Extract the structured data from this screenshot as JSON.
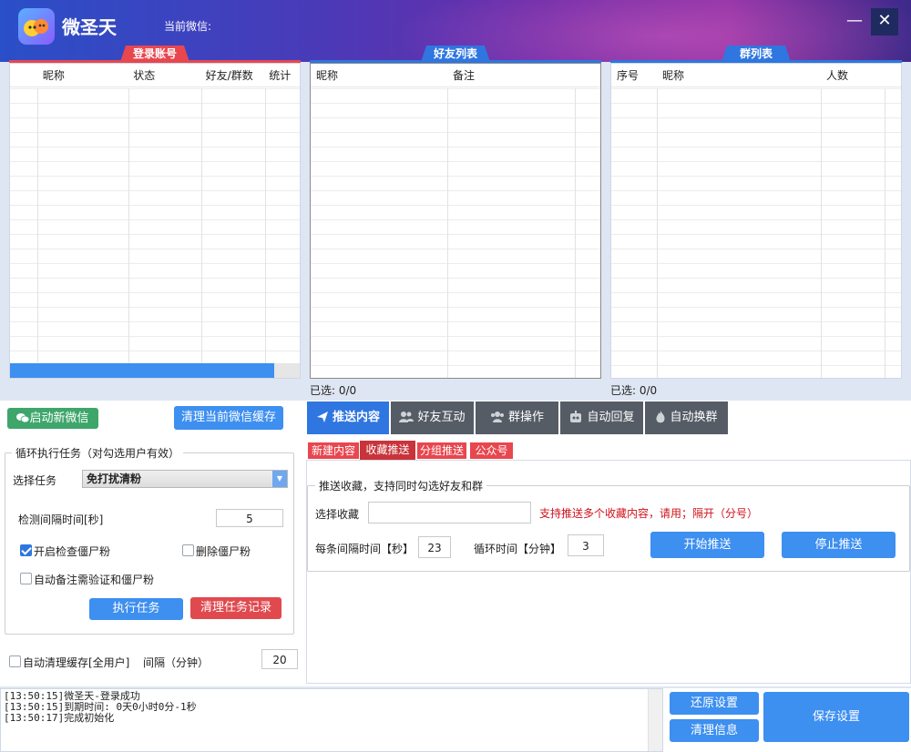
{
  "app": {
    "title": "微圣天",
    "current_wechat_label": "当前微信:"
  },
  "window": {
    "minimize": "—",
    "close": "✕"
  },
  "sections": {
    "login_accounts": "登录账号",
    "friend_list": "好友列表",
    "group_list": "群列表"
  },
  "login_table": {
    "columns": [
      "",
      "昵称",
      "状态",
      "好友/群数",
      "统计"
    ]
  },
  "friend_table": {
    "columns": [
      "昵称",
      "备注",
      ""
    ],
    "selected": "已选: 0/0"
  },
  "group_table": {
    "columns": [
      "序号",
      "昵称",
      "人数",
      ""
    ],
    "selected": "已选: 0/0"
  },
  "left": {
    "start_wechat": "启动新微信",
    "clear_cache": "清理当前微信缓存",
    "loop_legend": "循环执行任务（对勾选用户有效）",
    "select_task_label": "选择任务",
    "select_task_value": "免打扰清粉",
    "interval_label": "检测间隔时间[秒]",
    "interval_value": "5",
    "check_zombie": "开启检查僵尸粉",
    "delete_zombie": "删除僵尸粉",
    "auto_note": "自动备注需验证和僵尸粉",
    "run_task": "执行任务",
    "clear_task_log": "清理任务记录",
    "auto_clear_cache": "自动清理缓存[全用户]",
    "interval_min_label": "间隔（分钟）",
    "interval_min_value": "20"
  },
  "main_tabs": [
    {
      "label": "推送内容",
      "icon": "send-icon"
    },
    {
      "label": "好友互动",
      "icon": "users-icon"
    },
    {
      "label": "群操作",
      "icon": "group-icon"
    },
    {
      "label": "自动回复",
      "icon": "robot-icon"
    },
    {
      "label": "自动换群",
      "icon": "fire-icon"
    }
  ],
  "sub_tabs": [
    "新建内容",
    "收藏推送",
    "分组推送",
    "公众号"
  ],
  "push": {
    "legend": "推送收藏，支持同时勾选好友和群",
    "select_fav_label": "选择收藏",
    "select_fav_value": "",
    "hint": "支持推送多个收藏内容，请用；隔开（分号）",
    "each_interval_label": "每条间隔时间【秒】",
    "each_interval_value": "23",
    "loop_time_label": "循环时间【分钟】",
    "loop_time_value": "3",
    "start": "开始推送",
    "stop": "停止推送"
  },
  "log": [
    "[13:50:15]微圣天-登录成功",
    "[13:50:15]到期时间: 0天0小时0分-1秒",
    "[13:50:17]完成初始化"
  ],
  "bottom": {
    "restore": "还原设置",
    "clear_info": "清理信息",
    "save": "保存设置"
  },
  "colors": {
    "accent_blue": "#2f76e0",
    "accent_red": "#e8474f",
    "tab_dark": "#555c66",
    "hint_red": "#d0121b"
  }
}
